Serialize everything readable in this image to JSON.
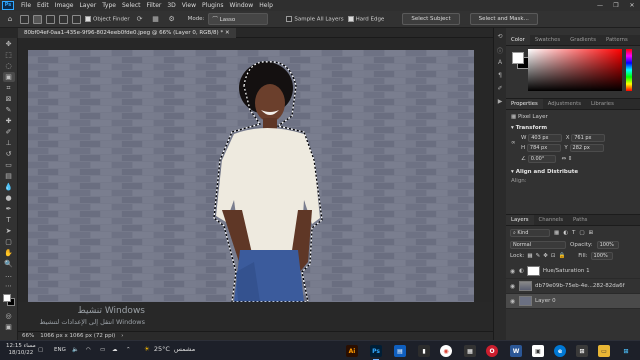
{
  "menu": {
    "logo": "Ps",
    "items": [
      "File",
      "Edit",
      "Image",
      "Layer",
      "Type",
      "Select",
      "Filter",
      "3D",
      "View",
      "Plugins",
      "Window",
      "Help"
    ]
  },
  "options": {
    "object_finder_label": "Object Finder",
    "mode_label": "Mode:",
    "mode_value": "Lasso",
    "sample_all_layers_label": "Sample All Layers",
    "hard_edge_label": "Hard Edge",
    "select_subject_label": "Select Subject",
    "select_and_mask_label": "Select and Mask..."
  },
  "document": {
    "tab_label": "80bf04ef-0aa1-435e-9f96-8024eeb0fde0.jpeg @ 66% (Layer 0, RGB/8) *"
  },
  "status": {
    "zoom": "66%",
    "doc_info": "1066 px x 1066 px (72 ppi)"
  },
  "watermark": {
    "line1": "تنشيط Windows",
    "line2": "انتقل إلى الإعدادات لتنشيط Windows"
  },
  "color_panel": {
    "tabs": [
      "Color",
      "Swatches",
      "Gradients",
      "Patterns"
    ],
    "active": 0,
    "foreground": "#ffffff",
    "background": "#000000",
    "field_hue": "#ff0000"
  },
  "properties": {
    "tabs": [
      "Properties",
      "Adjustments",
      "Libraries"
    ],
    "type_label": "Pixel Layer",
    "transform_title": "Transform",
    "w_label": "W",
    "w_value": "403 px",
    "h_label": "H",
    "h_value": "784 px",
    "x_label": "X",
    "x_value": "761 px",
    "y_label": "Y",
    "y_value": "282 px",
    "angle_value": "0.00°",
    "align_title": "Align and Distribute",
    "align_label": "Align:"
  },
  "layers_panel": {
    "tabs": [
      "Layers",
      "Channels",
      "Paths"
    ],
    "kind_label": "Kind",
    "blend_mode": "Normal",
    "opacity_label": "Opacity:",
    "opacity_value": "100%",
    "lock_label": "Lock:",
    "fill_label": "Fill:",
    "fill_value": "100%",
    "layers": [
      {
        "name": "Hue/Saturation 1",
        "selected": false,
        "kind": "adjustment"
      },
      {
        "name": "db79e09b-75eb-4e...282-82da6f5c9c9e...",
        "selected": false,
        "kind": "image"
      },
      {
        "name": "Layer 0",
        "selected": true,
        "kind": "image"
      }
    ]
  },
  "taskbar": {
    "time": "مساء 12:15",
    "date": "18/10/22",
    "lang": "ENG",
    "weather_temp": "25°C",
    "weather_label": "مشمس",
    "apps": [
      "Ai",
      "Ps",
      "Files",
      "Chrome",
      "Terminal",
      "Word",
      "Opera",
      "Edge",
      "Store",
      "Explorer",
      "Start"
    ]
  }
}
